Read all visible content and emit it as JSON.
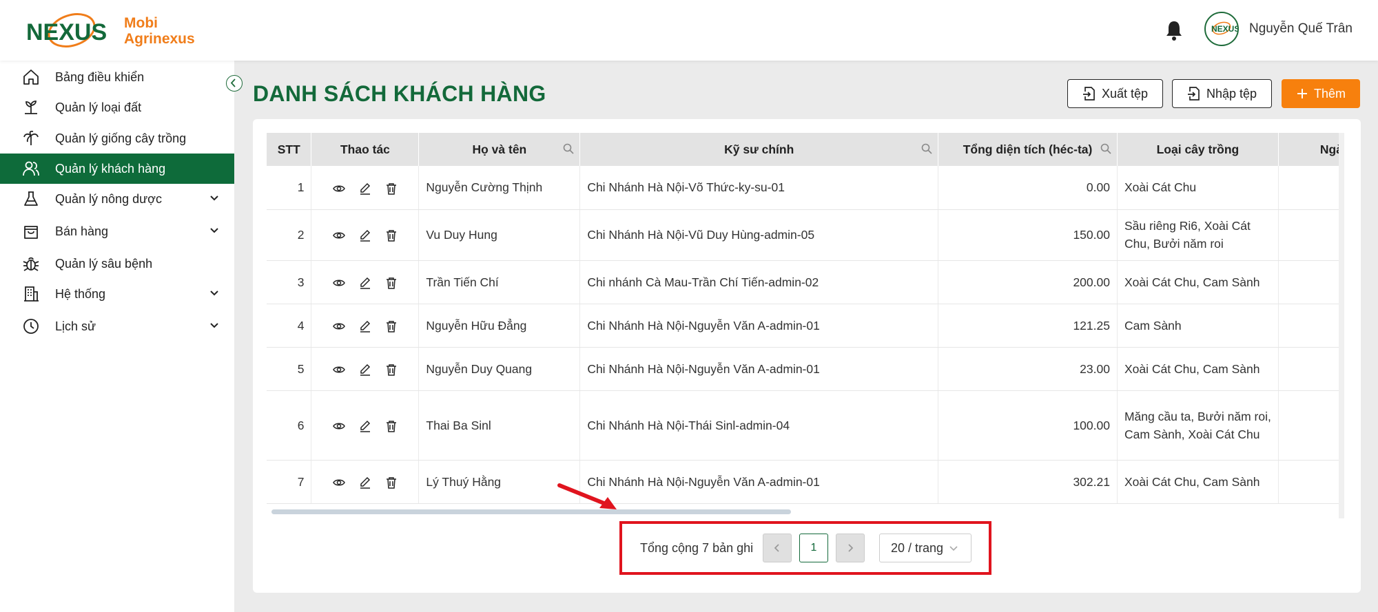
{
  "app": {
    "logo_line1": "Mobi",
    "logo_line2": "Agrinexus",
    "logo_mark": "NEXUS"
  },
  "user": {
    "name": "Nguyễn Quế Trân"
  },
  "sidebar": {
    "items": [
      {
        "label": "Bảng điều khiển",
        "icon": "home-icon",
        "expandable": false
      },
      {
        "label": "Quản lý loại đất",
        "icon": "soil-sprout-icon",
        "expandable": false
      },
      {
        "label": "Quản lý giống cây trồng",
        "icon": "palm-tree-icon",
        "expandable": false
      },
      {
        "label": "Quản lý khách hàng",
        "icon": "users-icon",
        "expandable": false,
        "active": true
      },
      {
        "label": "Quản lý nông dược",
        "icon": "flask-icon",
        "expandable": true
      },
      {
        "label": "Bán hàng",
        "icon": "shopping-bag-icon",
        "expandable": true
      },
      {
        "label": "Quản lý sâu bệnh",
        "icon": "bug-icon",
        "expandable": false
      },
      {
        "label": "Hệ thống",
        "icon": "building-icon",
        "expandable": true
      },
      {
        "label": "Lịch sử",
        "icon": "clock-icon",
        "expandable": true
      }
    ]
  },
  "page": {
    "title": "DANH SÁCH KHÁCH HÀNG",
    "export_label": "Xuất tệp",
    "import_label": "Nhập tệp",
    "add_label": "Thêm"
  },
  "table": {
    "columns": [
      "STT",
      "Thao tác",
      "Họ và tên",
      "Kỹ sư chính",
      "Tổng diện tích (héc-ta)",
      "Loại cây trồng",
      "Ngà"
    ],
    "rows": [
      {
        "stt": "1",
        "name": "Nguyễn Cường Thịnh",
        "engineer": "Chi Nhánh Hà Nội-Võ Thức-ky-su-01",
        "area": "0.00",
        "crops": "Xoài Cát Chu"
      },
      {
        "stt": "2",
        "name": "Vu Duy Hung",
        "engineer": "Chi Nhánh Hà Nội-Vũ Duy Hùng-admin-05",
        "area": "150.00",
        "crops": "Sầu riêng Ri6, Xoài Cát Chu, Bưởi năm roi"
      },
      {
        "stt": "3",
        "name": "Trần Tiến Chí",
        "engineer": "Chi nhánh Cà Mau-Trần Chí Tiến-admin-02",
        "area": "200.00",
        "crops": "Xoài Cát Chu, Cam Sành"
      },
      {
        "stt": "4",
        "name": "Nguyễn Hữu Đẳng",
        "engineer": "Chi Nhánh Hà Nội-Nguyễn Văn A-admin-01",
        "area": "121.25",
        "crops": "Cam Sành"
      },
      {
        "stt": "5",
        "name": "Nguyễn Duy Quang",
        "engineer": "Chi Nhánh Hà Nội-Nguyễn Văn A-admin-01",
        "area": "23.00",
        "crops": "Xoài Cát Chu, Cam Sành"
      },
      {
        "stt": "6",
        "name": "Thai Ba Sinl",
        "engineer": "Chi Nhánh Hà Nội-Thái Sinl-admin-04",
        "area": "100.00",
        "crops": "Măng cầu ta, Bưởi năm roi, Cam Sành, Xoài Cát Chu"
      },
      {
        "stt": "7",
        "name": "Lý Thuý Hằng",
        "engineer": "Chi Nhánh Hà Nội-Nguyễn Văn A-admin-01",
        "area": "302.21",
        "crops": "Xoài Cát Chu, Cam Sành"
      }
    ]
  },
  "pagination": {
    "total_text": "Tổng cộng 7 bản ghi",
    "current_page": "1",
    "page_size": "20 / trang"
  },
  "colors": {
    "brand_green": "#0e6b3a",
    "accent_orange": "#f7800d",
    "highlight_red": "#e0141e"
  }
}
